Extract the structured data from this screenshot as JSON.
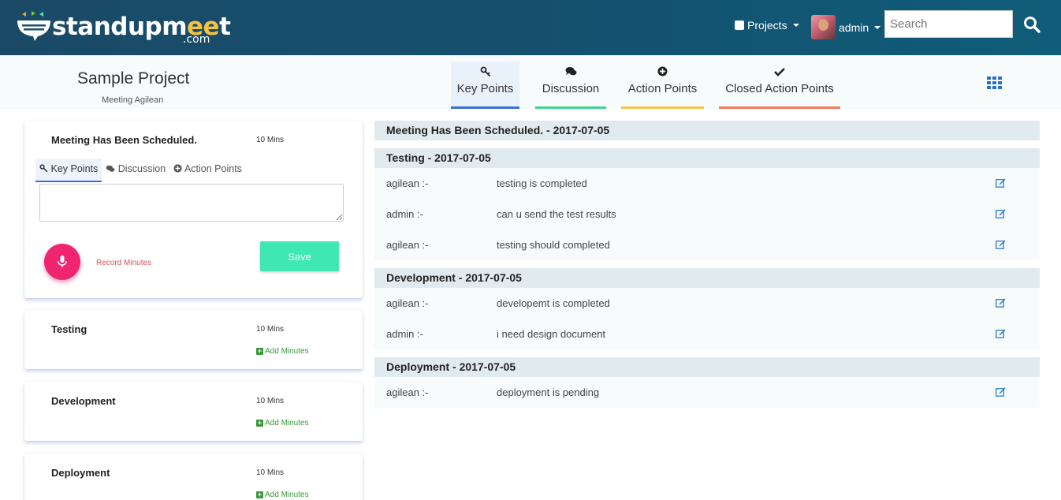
{
  "header": {
    "logo_text_main": "standupm",
    "logo_text_accent": "ee",
    "logo_text_end": "t",
    "logo_domain": ".com",
    "projects_label": "Projects",
    "user_name": "admin",
    "search_placeholder": "Search"
  },
  "project": {
    "title": "Sample Project",
    "subtitle": "Meeting Agilean"
  },
  "main_tabs": [
    {
      "label": "Key Points",
      "icon": "key-icon",
      "color": "#3a6fd8"
    },
    {
      "label": "Discussion",
      "icon": "comments-icon",
      "color": "#3dd68c"
    },
    {
      "label": "Action Points",
      "icon": "plus-circle-icon",
      "color": "#f5c542"
    },
    {
      "label": "Closed Action Points",
      "icon": "check-icon",
      "color": "#ef7b5a"
    }
  ],
  "agenda": [
    {
      "title": "Meeting Has Been Scheduled.",
      "duration": "10 Mins",
      "tabs": [
        "Key Points",
        "Discussion",
        "Action Points"
      ],
      "notes_value": "",
      "record_label": "Record Minutes",
      "save_label": "Save"
    },
    {
      "title": "Testing",
      "duration": "10 Mins",
      "add_label": "Add Minutes"
    },
    {
      "title": "Development",
      "duration": "10 Mins",
      "add_label": "Add Minutes"
    },
    {
      "title": "Deployment",
      "duration": "10 Mins",
      "add_label": "Add Minutes"
    }
  ],
  "minutes": [
    {
      "heading": "Meeting Has Been Scheduled. - 2017-07-05",
      "entries": []
    },
    {
      "heading": "Testing - 2017-07-05",
      "entries": [
        {
          "author": "agilean :-",
          "text": "testing is completed"
        },
        {
          "author": "admin :-",
          "text": "can u send the test results"
        },
        {
          "author": "agilean :-",
          "text": "testing should completed"
        }
      ]
    },
    {
      "heading": "Development - 2017-07-05",
      "entries": [
        {
          "author": "agilean :-",
          "text": "developemt is completed"
        },
        {
          "author": "admin :-",
          "text": "i need design document"
        }
      ]
    },
    {
      "heading": "Deployment - 2017-07-05",
      "entries": [
        {
          "author": "agilean :-",
          "text": "deployment is pending"
        }
      ]
    }
  ],
  "colors": {
    "header_bg": "#14506e",
    "accent_yellow": "#f5c242",
    "save_green": "#3ee8b0",
    "mic_pink": "#f0256f",
    "link_edit": "#2a7bd0"
  }
}
